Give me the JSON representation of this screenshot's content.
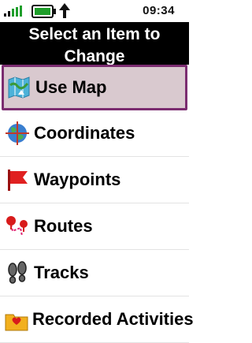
{
  "status": {
    "time": "09:34",
    "signal_icon": "signal-bars-icon",
    "battery_icon": "battery-icon",
    "gps_icon": "gps-arrow-icon",
    "accent": "#1f9e2b"
  },
  "header": {
    "title_line1": "Select an Item to",
    "title_line2": "Change"
  },
  "menu": {
    "selected_color": "#d9c9cf",
    "selected_border": "#7b2c70",
    "items": [
      {
        "label": "Use Map",
        "icon": "map-icon",
        "selected": true
      },
      {
        "label": "Coordinates",
        "icon": "globe-crosshair-icon",
        "selected": false
      },
      {
        "label": "Waypoints",
        "icon": "red-flag-icon",
        "selected": false
      },
      {
        "label": "Routes",
        "icon": "route-pins-icon",
        "selected": false
      },
      {
        "label": "Tracks",
        "icon": "footprints-icon",
        "selected": false
      },
      {
        "label": "Recorded Activities",
        "icon": "folder-icon",
        "selected": false
      }
    ]
  }
}
